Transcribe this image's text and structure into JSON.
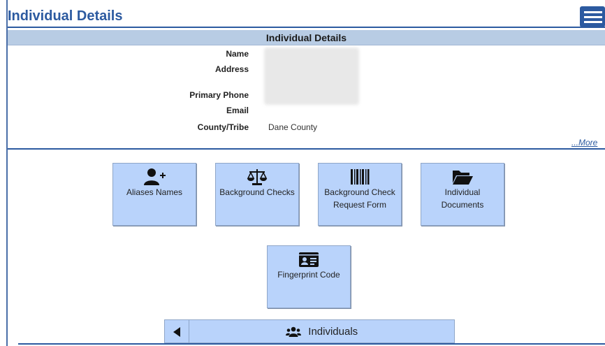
{
  "page": {
    "title": "Individual Details"
  },
  "details": {
    "header": "Individual Details",
    "fields": [
      {
        "label": "Name",
        "value": ""
      },
      {
        "label": "Address",
        "value": ""
      },
      {
        "label": "Primary Phone",
        "value": ""
      },
      {
        "label": "Email",
        "value": ""
      },
      {
        "label": "County/Tribe",
        "value": "Dane County"
      }
    ],
    "more_link": "...More"
  },
  "tiles": [
    {
      "label": "Aliases Names",
      "icon": "person-plus-icon"
    },
    {
      "label": "Background Checks",
      "icon": "scales-icon"
    },
    {
      "label": "Background Check Request Form",
      "icon": "barcode-icon"
    },
    {
      "label": "Individual Documents",
      "icon": "folder-open-icon"
    },
    {
      "label": "Fingerprint Code",
      "icon": "id-card-icon"
    }
  ],
  "nav": {
    "back_icon": "triangle-left-icon",
    "label": "Individuals",
    "icon": "users-icon"
  },
  "colors": {
    "brand": "#2c5aa0",
    "header_bg": "#b8cce4",
    "tile_bg": "#b9d3fb"
  }
}
